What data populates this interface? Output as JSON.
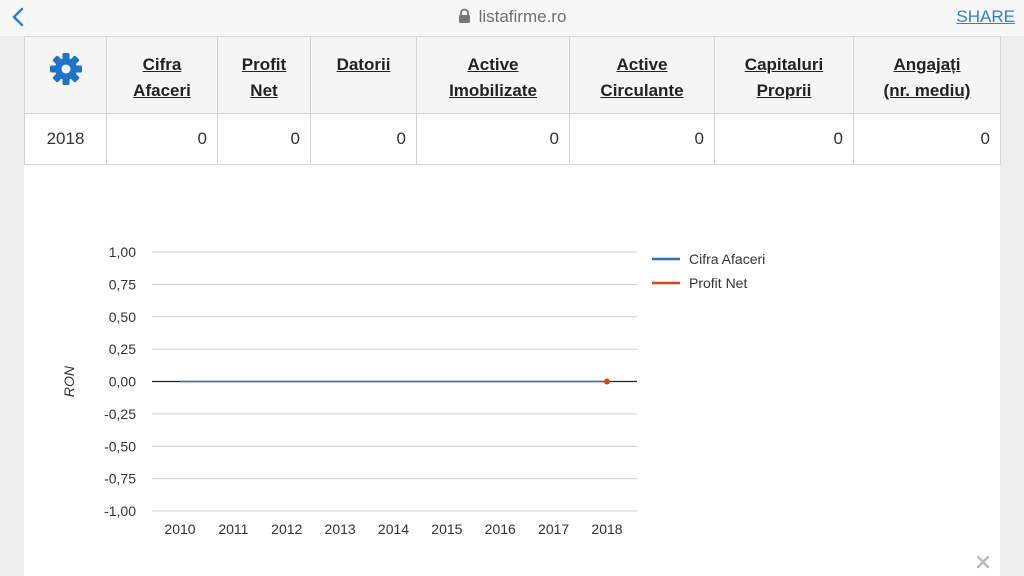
{
  "browser": {
    "url": "listafirme.ro",
    "share_label": "SHARE"
  },
  "table": {
    "headers": [
      {
        "line1": "Cifra",
        "line2": "Afaceri"
      },
      {
        "line1": "Profit",
        "line2": "Net"
      },
      {
        "line1": "Datorii",
        "line2": ""
      },
      {
        "line1": "Active",
        "line2": "Imobilizate"
      },
      {
        "line1": "Active",
        "line2": "Circulante"
      },
      {
        "line1": "Capitaluri",
        "line2": "Proprii"
      },
      {
        "line1": "Angajați",
        "line2": "(nr. mediu)"
      }
    ],
    "row": {
      "year": "2018",
      "values": [
        "0",
        "0",
        "0",
        "0",
        "0",
        "0",
        "0"
      ]
    }
  },
  "chart_data": {
    "type": "line",
    "x": [
      "2010",
      "2011",
      "2012",
      "2013",
      "2014",
      "2015",
      "2016",
      "2017",
      "2018"
    ],
    "series": [
      {
        "name": "Cifra Afaceri",
        "color": "#3b6bb5",
        "values": [
          0,
          0,
          0,
          0,
          0,
          0,
          0,
          0,
          0
        ]
      },
      {
        "name": "Profit Net",
        "color": "#d0471f",
        "values": [
          null,
          null,
          null,
          null,
          null,
          null,
          null,
          null,
          0
        ]
      }
    ],
    "ylabel": "RON",
    "ylim": [
      -1,
      1
    ],
    "yticks": [
      "1,00",
      "0,75",
      "0,50",
      "0,25",
      "0,00",
      "-0,25",
      "-0,50",
      "-0,75",
      "-1,00"
    ],
    "grid": true,
    "legend": "right"
  }
}
